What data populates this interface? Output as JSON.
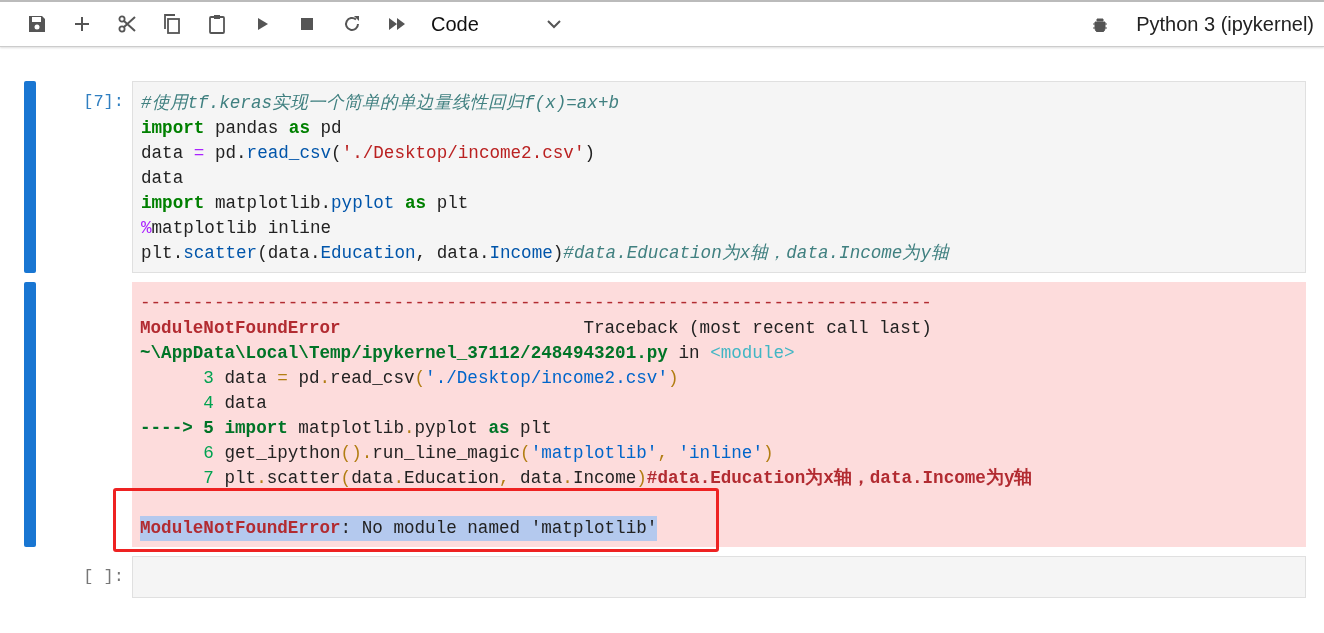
{
  "toolbar": {
    "cell_type": "Code",
    "kernel": "Python 3 (ipykernel)"
  },
  "cells": [
    {
      "prompt": "[7]:",
      "selected": true,
      "input": [
        [
          {
            "comment": "#使用tf.keras实现一个简单的单边量线性回归f(x)=ax+b"
          }
        ],
        [
          {
            "kw": "import"
          },
          {
            "plain": " pandas "
          },
          {
            "kw": "as"
          },
          {
            "plain": " pd"
          }
        ],
        [
          {
            "plain": "data "
          },
          {
            "op": "="
          },
          {
            "plain": " pd."
          },
          {
            "fn": "read_csv"
          },
          {
            "plain": "("
          },
          {
            "str": "'./Desktop/income2.csv'"
          },
          {
            "plain": ")"
          }
        ],
        [
          {
            "plain": "data"
          }
        ],
        [
          {
            "kw": "import"
          },
          {
            "plain": " matplotlib."
          },
          {
            "fn": "pyplot"
          },
          {
            "kw": " as"
          },
          {
            "plain": " plt"
          }
        ],
        [
          {
            "op": "%"
          },
          {
            "plain": "matplotlib inline"
          }
        ],
        [
          {
            "plain": "plt."
          },
          {
            "fn": "scatter"
          },
          {
            "plain": "(data."
          },
          {
            "fn": "Education"
          },
          {
            "plain": ", data."
          },
          {
            "fn": "Income"
          },
          {
            "plain": ")"
          },
          {
            "comment": "#data.Education为x轴，data.Income为y轴"
          }
        ]
      ],
      "traceback": [
        [
          {
            "dash": "---------------------------------------------------------------------------"
          }
        ],
        [
          {
            "err": "ModuleNotFoundError"
          },
          {
            "plain": "                       Traceback (most recent call last)"
          }
        ],
        [
          {
            "path": "~\\AppData\\Local\\Temp/ipykernel_37112/2484943201.py"
          },
          {
            "plain": " in "
          },
          {
            "module": "<module>"
          }
        ],
        [
          {
            "num": "      3"
          },
          {
            "plain": " data "
          },
          {
            "paren": "="
          },
          {
            "plain": " pd"
          },
          {
            "paren": "."
          },
          {
            "plain": "read_csv"
          },
          {
            "paren": "("
          },
          {
            "ostr": "'./Desktop/income2.csv'"
          },
          {
            "paren": ")"
          }
        ],
        [
          {
            "num": "      4"
          },
          {
            "plain": " data"
          }
        ],
        [
          {
            "path": "----> 5 import"
          },
          {
            "plain": " matplotlib"
          },
          {
            "paren": "."
          },
          {
            "plain": "pyplot "
          },
          {
            "path": "as"
          },
          {
            "plain": " plt"
          }
        ],
        [
          {
            "num": "      6"
          },
          {
            "plain": " get_ipython"
          },
          {
            "paren": "()."
          },
          {
            "plain": "run_line_magic"
          },
          {
            "paren": "("
          },
          {
            "ostr": "'matplotlib'"
          },
          {
            "paren": ","
          },
          {
            "ostr": " 'inline'"
          },
          {
            "paren": ")"
          }
        ],
        [
          {
            "num": "      7"
          },
          {
            "plain": " plt"
          },
          {
            "paren": "."
          },
          {
            "plain": "scatter"
          },
          {
            "paren": "("
          },
          {
            "plain": "data"
          },
          {
            "paren": "."
          },
          {
            "plain": "Education"
          },
          {
            "paren": ","
          },
          {
            "plain": " data"
          },
          {
            "paren": "."
          },
          {
            "plain": "Income"
          },
          {
            "paren": ")"
          },
          {
            "ocomment": "#data.Education为x轴，data.Income为y轴"
          }
        ]
      ],
      "message": {
        "selected": true,
        "annotated": true,
        "tokens": [
          {
            "err": "ModuleNotFoundError"
          },
          {
            "plain": ": No module named 'matplotlib'"
          }
        ]
      }
    },
    {
      "prompt": "[ ]:",
      "selected": false
    }
  ]
}
